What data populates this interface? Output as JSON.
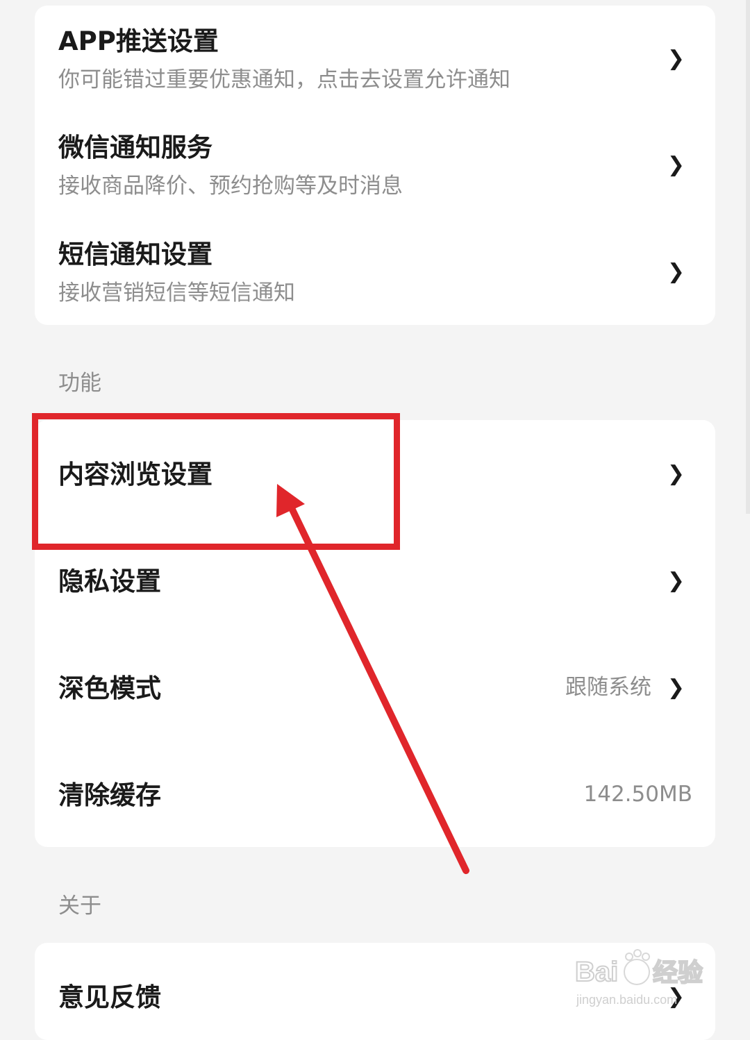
{
  "notifications": {
    "items": [
      {
        "title": "APP推送设置",
        "subtitle": "你可能错过重要优惠通知，点击去设置允许通知"
      },
      {
        "title": "微信通知服务",
        "subtitle": "接收商品降价、预约抢购等及时消息"
      },
      {
        "title": "短信通知设置",
        "subtitle": "接收营销短信等短信通知"
      }
    ]
  },
  "features": {
    "section_label": "功能",
    "items": [
      {
        "title": "内容浏览设置"
      },
      {
        "title": "隐私设置"
      },
      {
        "title": "深色模式",
        "value": "跟随系统"
      },
      {
        "title": "清除缓存",
        "value": "142.50MB"
      }
    ]
  },
  "about": {
    "section_label": "关于",
    "items": [
      {
        "title": "意见反馈"
      }
    ]
  },
  "chevron_glyph": "❯",
  "annotation": {
    "color": "#e0262b",
    "icon": "arrow-pointer"
  },
  "watermark": {
    "brand": "Baidu经验",
    "url": "jingyan.baidu.com"
  }
}
